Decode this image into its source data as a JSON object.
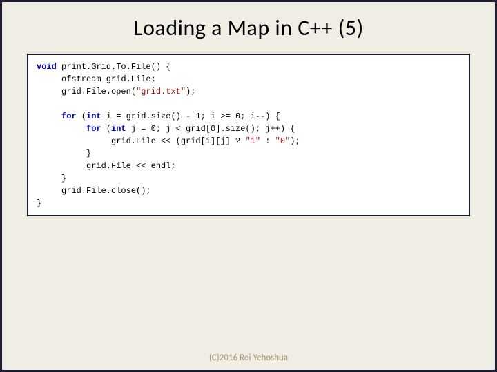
{
  "title": "Loading a Map in C++ (5)",
  "code": {
    "l1_kw": "void",
    "l1_rest": " print.Grid.To.File() {",
    "l2": "ofstream grid.File;",
    "l3a": "grid.File.open(",
    "l3s": "\"grid.txt\"",
    "l3b": ");",
    "l4_kw": "for",
    "l4a": " (",
    "l4_kw2": "int",
    "l4b": " i = grid.size() - 1; i >= 0; i--) {",
    "l5_kw": "for",
    "l5a": " (",
    "l5_kw2": "int",
    "l5b": " j = 0; j < grid[0].size(); j++) {",
    "l6a": "grid.File << (grid[i][j] ? ",
    "l6s1": "\"1\"",
    "l6b": " : ",
    "l6s2": "\"0\"",
    "l6c": ");",
    "l7": "}",
    "l8": "grid.File << endl;",
    "l9": "}",
    "l10": "grid.File.close();",
    "l11": "}"
  },
  "footer": "(C)2016 Roi Yehoshua"
}
